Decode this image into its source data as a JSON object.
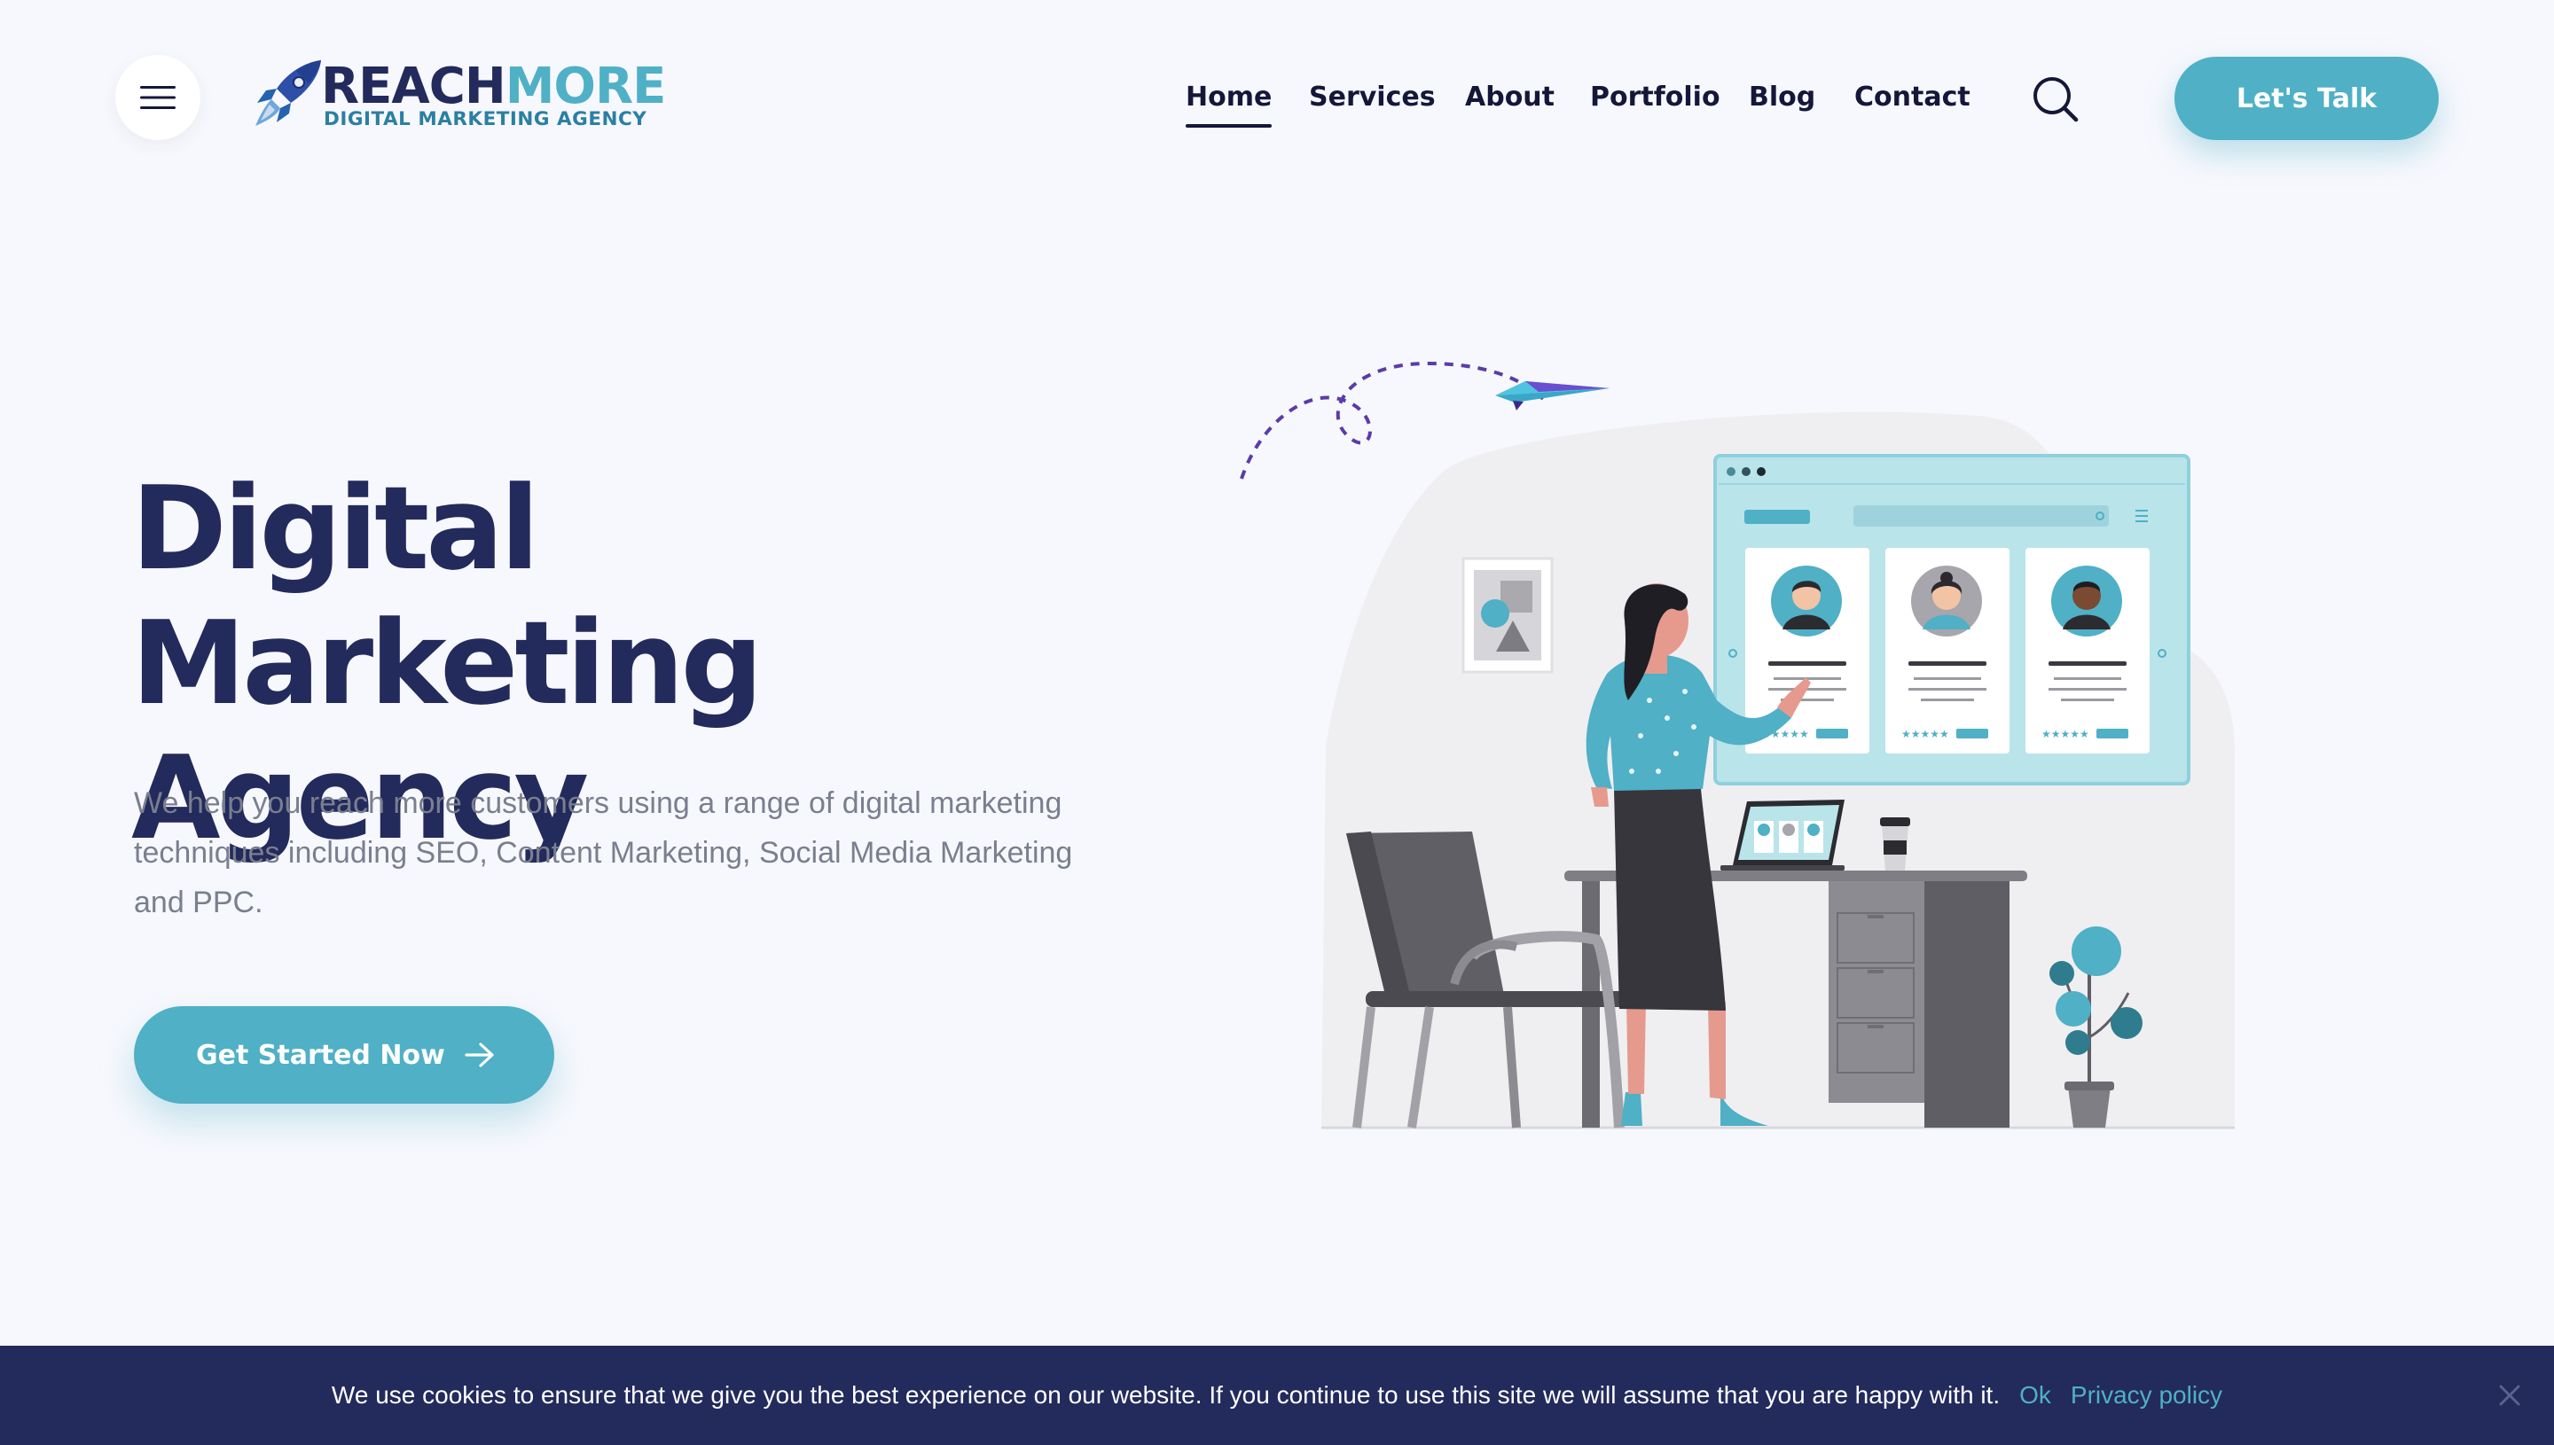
{
  "brand": {
    "name_part1": "REACH",
    "name_part2": "MORE",
    "tagline": "DIGITAL MARKETING AGENCY",
    "colors": {
      "primary": "#232a5c",
      "accent": "#4fb0c6",
      "background": "#f7f8fd"
    }
  },
  "header": {
    "menu_icon": "hamburger-menu-icon",
    "search_icon": "search-icon",
    "nav": [
      {
        "label": "Home",
        "active": true
      },
      {
        "label": "Services",
        "active": false
      },
      {
        "label": "About",
        "active": false
      },
      {
        "label": "Portfolio",
        "active": false
      },
      {
        "label": "Blog",
        "active": false
      },
      {
        "label": "Contact",
        "active": false
      }
    ],
    "cta_label": "Let's Talk"
  },
  "hero": {
    "title_line1": "Digital Marketing",
    "title_line2": "Agency",
    "description": "We help you reach more customers using a range of digital marketing techniques including SEO, Content Marketing, Social Media Marketing and PPC.",
    "cta_label": "Get Started Now",
    "cta_icon": "arrow-right-icon"
  },
  "cookie_notice": {
    "text": "We use cookies to ensure that we give you the best experience on our website. If you continue to use this site we will assume that you are happy with it.",
    "ok_label": "Ok",
    "policy_label": "Privacy policy",
    "close_icon": "close-icon"
  }
}
